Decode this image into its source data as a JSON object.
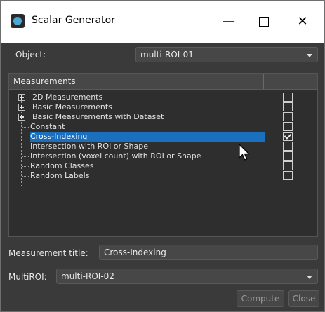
{
  "window": {
    "title": "Scalar Generator",
    "minimize_glyph": "—",
    "close_glyph": "✕"
  },
  "object": {
    "label": "Object:",
    "value": "multi-ROI-01"
  },
  "tree": {
    "header": "Measurements",
    "items": [
      {
        "label": "2D Measurements",
        "expandable": true,
        "checked": false
      },
      {
        "label": "Basic Measurements",
        "expandable": true,
        "checked": false
      },
      {
        "label": "Basic Measurements with Dataset",
        "expandable": true,
        "checked": false
      },
      {
        "label": "Constant",
        "expandable": false,
        "checked": false
      },
      {
        "label": "Cross-Indexing",
        "expandable": false,
        "checked": true,
        "selected": true
      },
      {
        "label": "Intersection with ROI or Shape",
        "expandable": false,
        "checked": false
      },
      {
        "label": "Intersection (voxel count) with ROI or Shape",
        "expandable": false,
        "checked": false
      },
      {
        "label": "Random Classes",
        "expandable": false,
        "checked": false
      },
      {
        "label": "Random Labels",
        "expandable": false,
        "checked": false
      }
    ]
  },
  "measurement_title": {
    "label": "Measurement title:",
    "value": "Cross-Indexing"
  },
  "multiroi": {
    "label": "MultiROI:",
    "value": "multi-ROI-02"
  },
  "buttons": {
    "compute": "Compute",
    "close": "Close"
  },
  "colors": {
    "selection": "#1a6fbf",
    "panel": "#3a3a3a"
  }
}
